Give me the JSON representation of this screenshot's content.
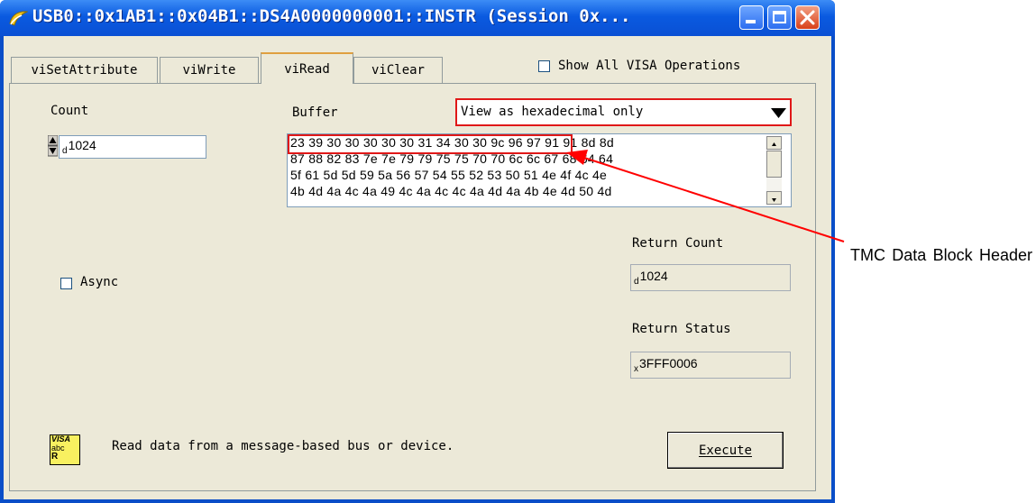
{
  "window": {
    "title": "USB0::0x1AB1::0x04B1::DS4A0000000001::INSTR (Session 0x..."
  },
  "tabs": [
    {
      "label": "viSetAttribute"
    },
    {
      "label": "viWrite"
    },
    {
      "label": "viRead"
    },
    {
      "label": "viClear"
    }
  ],
  "show_all": {
    "label": "Show All VISA Operations",
    "checked": false
  },
  "count": {
    "label": "Count",
    "radix": "d",
    "value": "1024"
  },
  "buffer": {
    "label": "Buffer",
    "view_mode": "View as hexadecimal only",
    "lines": [
      "23 39 30 30 30 30 30 31 34 30 30 9c 96 97 91 91 8d 8d",
      "87 88 82 83 7e 7e 79 79 75 75 70 70 6c 6c 67 68 64 64",
      "5f 61 5d 5d 59 5a 56 57 54 55 52 53 50 51 4e 4f 4c 4e",
      "4b 4d 4a 4c 4a 49 4c 4a 4c 4c 4a 4d 4a 4b 4e 4d 50 4d"
    ]
  },
  "async": {
    "label": "Async",
    "checked": false
  },
  "return_count": {
    "label": "Return Count",
    "radix": "d",
    "value": "1024"
  },
  "return_status": {
    "label": "Return Status",
    "radix": "x",
    "value": "3FFF0006"
  },
  "description": "Read data from a message-based bus or device.",
  "execute": {
    "label": "Execute"
  },
  "visa_icon": {
    "line1": "VISA",
    "line2": "abc",
    "line3": "R"
  },
  "annotation": {
    "text": "TMC Data Block Header",
    "color": "#ff0000"
  },
  "colors": {
    "titlebar": "#0a5ae0",
    "client": "#ece9d8",
    "highlight": "#ff0000"
  }
}
